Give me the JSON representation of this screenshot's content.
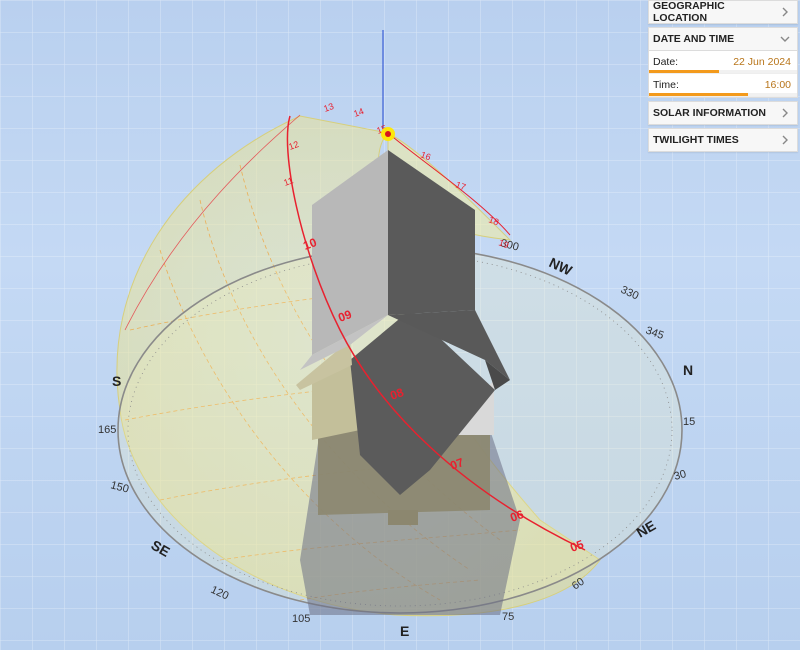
{
  "panel": {
    "geographic_location": "GEOGRAPHIC LOCATION",
    "date_and_time": "DATE AND TIME",
    "date_label": "Date:",
    "date_value": "22 Jun 2024",
    "date_progress": 0.47,
    "time_label": "Time:",
    "time_value": "16:00",
    "time_progress": 0.67,
    "solar_information": "SOLAR INFORMATION",
    "twilight_times": "TWILIGHT TIMES"
  },
  "compass": {
    "labels": {
      "N": "N",
      "NE": "NE",
      "E": "E",
      "SE": "SE",
      "S": "S",
      "NW": "NW",
      "d15": "15",
      "d30": "30",
      "d60": "60",
      "d75": "75",
      "d105": "105",
      "d120": "120",
      "d150": "150",
      "d165": "165",
      "d285": "285",
      "d300": "300",
      "d330": "330",
      "d345": "345"
    }
  },
  "sun_path": {
    "hours": [
      "05",
      "06",
      "07",
      "08",
      "09",
      "10",
      "11",
      "12",
      "13",
      "14",
      "15",
      "16",
      "17",
      "18",
      "19"
    ]
  },
  "colors": {
    "sun_dome": "#f1eb9c",
    "sun_path_line": "#e8212f",
    "compass_ring": "#888888",
    "north_pole_axis": "#3a5ed6",
    "building_light": "#b9b9b9",
    "building_dark": "#5a5a5a",
    "accent_orange": "#f39a1c"
  },
  "icons": {
    "collapsed": "chevron-right-icon",
    "expanded": "chevron-down-icon"
  }
}
